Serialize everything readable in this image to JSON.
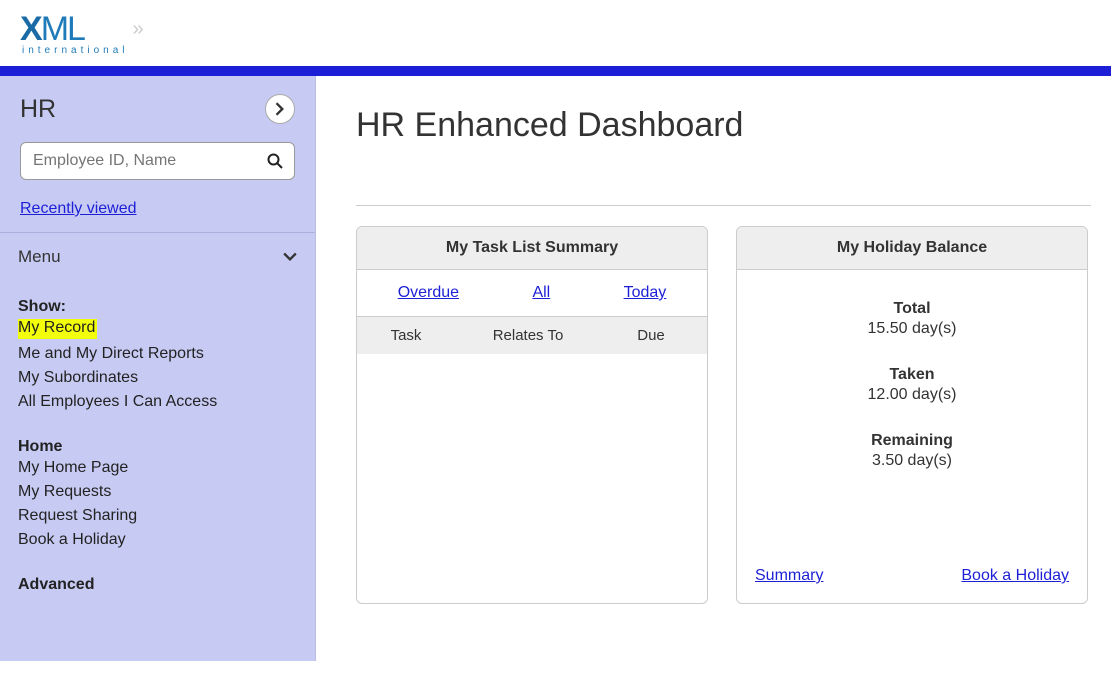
{
  "logo": {
    "text": "XML",
    "subtitle": "international"
  },
  "sidebar": {
    "title": "HR",
    "search_placeholder": "Employee ID, Name",
    "recently_viewed": "Recently viewed",
    "menu_label": "Menu",
    "groups": {
      "show": {
        "label": "Show:",
        "items": [
          "My Record",
          "Me and My Direct Reports",
          "My Subordinates",
          "All Employees I Can Access"
        ]
      },
      "home": {
        "label": "Home",
        "items": [
          "My Home Page",
          "My Requests",
          "Request Sharing",
          "Book a Holiday"
        ]
      },
      "advanced": {
        "label": "Advanced"
      }
    }
  },
  "main": {
    "title": "HR Enhanced Dashboard"
  },
  "task_card": {
    "title": "My Task List Summary",
    "tabs": {
      "overdue": "Overdue",
      "all": "All",
      "today": "Today"
    },
    "cols": {
      "task": "Task",
      "relates": "Relates To",
      "due": "Due"
    }
  },
  "holiday_card": {
    "title": "My Holiday Balance",
    "total_label": "Total",
    "total_value": "15.50 day(s)",
    "taken_label": "Taken",
    "taken_value": "12.00 day(s)",
    "remaining_label": "Remaining",
    "remaining_value": "3.50 day(s)",
    "summary_link": "Summary",
    "book_link": "Book a Holiday"
  }
}
